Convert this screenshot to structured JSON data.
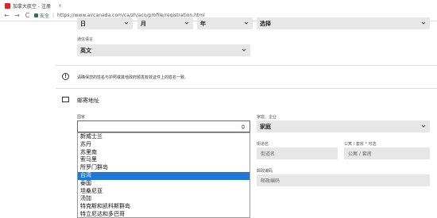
{
  "browser": {
    "tab_title": "加拿大航空 - 注册",
    "tab_close": "×",
    "secure_label": "安全",
    "separator": "|",
    "url": "https://www.aircanada.com/ca/zh/aco/profile/registration.html",
    "back": "←",
    "forward": "→",
    "reload": "C"
  },
  "birthdate": {
    "day": "日",
    "month": "月",
    "year": "年",
    "gender": "选择"
  },
  "language": {
    "label": "通信语言",
    "value": "英文"
  },
  "notice": {
    "icon": "!",
    "text": "请确保您的姓名与护照或其他政府颁发有效证件上的姓名一致。"
  },
  "mailing": {
    "title": "邮寄地址"
  },
  "country": {
    "label": "国家",
    "value": "",
    "options": [
      "新威士兰",
      "苏丹",
      "苏里南",
      "索马里",
      "所罗门群岛",
      "台湾",
      "泰国",
      "坦桑尼亚",
      "汤加",
      "特克斯和凯科斯群岛",
      "特立尼达和多巴哥"
    ],
    "selected_index": 5
  },
  "address_type": {
    "label": "家庭、企业",
    "value": "家庭"
  },
  "street": {
    "label": "街道名",
    "placeholder": "街道名"
  },
  "apartment": {
    "label": "公寓 / 套房 * 可选",
    "placeholder": "公寓 / 套房"
  },
  "postal": {
    "label": "邮政编码",
    "placeholder": "邮政编码"
  }
}
